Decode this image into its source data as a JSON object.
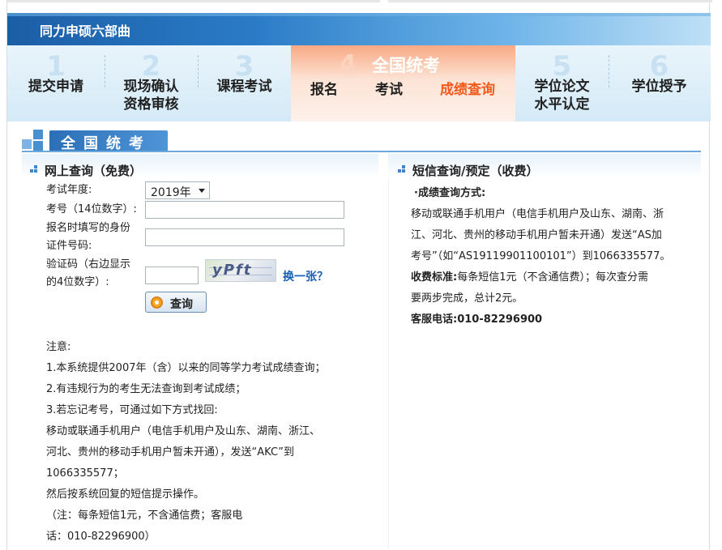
{
  "header": {
    "title": "同力申硕六部曲"
  },
  "steps": [
    {
      "num": "1",
      "label_line1": "提交申请",
      "label_line2": ""
    },
    {
      "num": "2",
      "label_line1": "现场确认",
      "label_line2": "资格审核"
    },
    {
      "num": "3",
      "label_line1": "课程考试",
      "label_line2": ""
    },
    {
      "num": "4",
      "title": "全国统考",
      "subs": [
        "报名",
        "考试",
        "成绩查询"
      ]
    },
    {
      "num": "5",
      "label_line1": "学位论文",
      "label_line2": "水平认定"
    },
    {
      "num": "6",
      "label_line1": "学位授予",
      "label_line2": ""
    }
  ],
  "section": {
    "title": "全国统考"
  },
  "left_panel": {
    "title": "网上查询（免费）",
    "year_label": "考试年度:",
    "year_value": "2019年",
    "exam_no_label": "考号（14位数字）:",
    "id_label_line1": "报名时填写的身份",
    "id_label_line2": "证件号码:",
    "captcha_label_line1": "验证码（右边显示",
    "captcha_label_line2": "的4位数字）:",
    "captcha_text": "yPft",
    "swap_label": "换一张？",
    "query_button": "查询"
  },
  "notes": [
    "注意:",
    "1.本系统提供2007年（含）以来的同等学力考试成绩查询；",
    "2.有违规行为的考生无法查询到考试成绩；",
    "3.若忘记考号，可通过如下方式找回:",
    "移动或联通手机用户（电信手机用户及山东、湖南、浙江、",
    "河北、贵州的移动手机用户暂未开通），发送“AKC”到",
    "1066335577；",
    "然后按系统回复的短信提示操作。",
    "（注：每条短信1元，不含通信费；客服电",
    "话：010-82296900）"
  ],
  "right_panel": {
    "title": "短信查询/预定（收费）",
    "method_label": "·成绩查询方式:",
    "method_text_line1": "移动或联通手机用户（电信手机用户及山东、湖南、浙",
    "method_text_line2": "江、河北、贵州的移动手机用户暂未开通）发送“AS加",
    "method_text_line3": "考号”（如“AS19119901100101”）到1066335577。",
    "fee_label": "收费标准:",
    "fee_text_line1": "每条短信1元（不含通信费）；每次查分需",
    "fee_text_line2": "要两步完成，总计2元。",
    "phone_label": "客服电话:",
    "phone_value": "010-82296900"
  }
}
